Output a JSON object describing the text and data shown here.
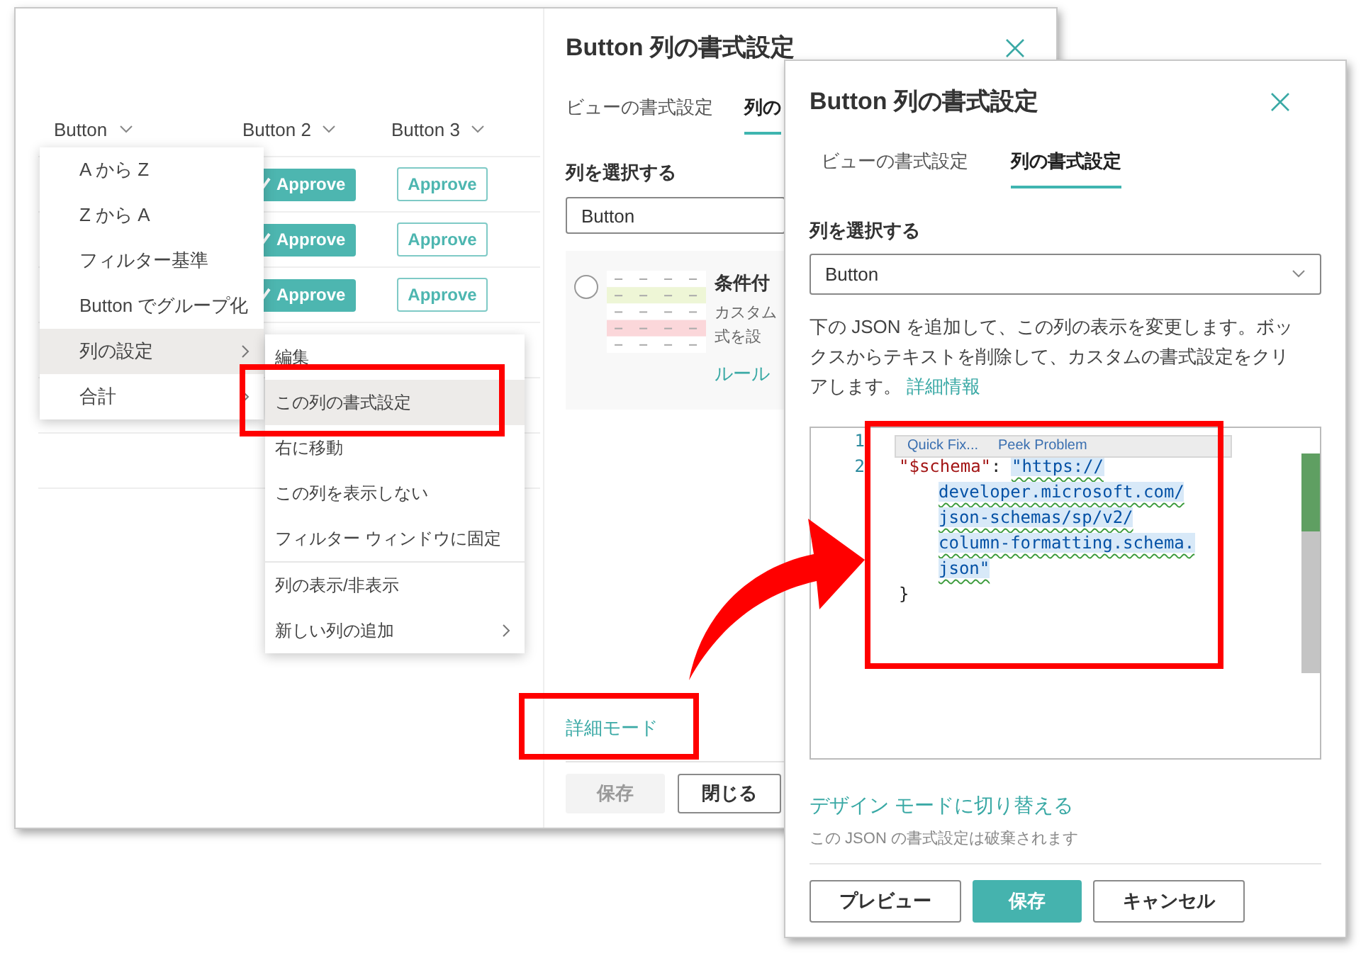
{
  "list_window": {
    "columns": [
      {
        "label": "Button"
      },
      {
        "label": "Button 2"
      },
      {
        "label": "Button 3"
      }
    ],
    "rows": [
      {
        "cells": [
          {
            "kind": "filled",
            "label": "Approve"
          },
          {
            "kind": "outlined",
            "label": "Approve"
          }
        ]
      },
      {
        "cells": [
          {
            "kind": "filled",
            "label": "Approve"
          },
          {
            "kind": "outlined",
            "label": "Approve"
          }
        ]
      },
      {
        "cells": [
          {
            "kind": "filled",
            "label": "Approve"
          },
          {
            "kind": "outlined",
            "label": "Approve"
          }
        ]
      }
    ],
    "column_menu": {
      "items": [
        {
          "label": "A から Z",
          "selected": false,
          "submenu": false
        },
        {
          "label": "Z から A",
          "selected": false,
          "submenu": false
        },
        {
          "label": "フィルター基準",
          "selected": false,
          "submenu": false
        },
        {
          "label": "Button でグループ化",
          "selected": false,
          "submenu": false
        },
        {
          "label": "列の設定",
          "selected": true,
          "submenu": true
        },
        {
          "label": "合計",
          "selected": false,
          "submenu": true
        }
      ]
    },
    "settings_submenu": {
      "items": [
        {
          "label": "編集",
          "selected": false,
          "submenu": false,
          "divider_before": false
        },
        {
          "label": "この列の書式設定",
          "selected": true,
          "submenu": false,
          "divider_before": false
        },
        {
          "label": "右に移動",
          "selected": false,
          "submenu": false,
          "divider_before": false
        },
        {
          "label": "この列を表示しない",
          "selected": false,
          "submenu": false,
          "divider_before": false
        },
        {
          "label": "フィルター ウィンドウに固定",
          "selected": false,
          "submenu": false,
          "divider_before": false
        },
        {
          "label": "列の表示/非表示",
          "selected": false,
          "submenu": false,
          "divider_before": true
        },
        {
          "label": "新しい列の追加",
          "selected": false,
          "submenu": true,
          "divider_before": false
        }
      ]
    },
    "format_panel": {
      "title": "Button 列の書式設定",
      "tabs": [
        {
          "label": "ビューの書式設定",
          "selected": false
        },
        {
          "label": "列の",
          "selected": true
        }
      ],
      "select_label": "列を選択する",
      "select_value": "Button",
      "rule_card": {
        "selected": false,
        "title": "条件付",
        "description_lines": [
          "カスタム",
          "式を設"
        ],
        "link": "ルール"
      },
      "advanced_link": "詳細モード",
      "buttons": [
        {
          "label": "保存",
          "kind": "primary",
          "disabled": true
        },
        {
          "label": "閉じる",
          "kind": "default",
          "disabled": false
        }
      ]
    }
  },
  "front_panel": {
    "title": "Button 列の書式設定",
    "tabs": [
      {
        "label": "ビューの書式設定",
        "selected": false
      },
      {
        "label": "列の書式設定",
        "selected": true
      }
    ],
    "select_label": "列を選択する",
    "select_value": "Button",
    "description": "下の JSON を追加して、この列の表示を変更します。ボックスからテキストを削除して、カスタムの書式設定をクリアします。",
    "learn_more_link": "詳細情報",
    "editor": {
      "hover_actions": [
        "Quick Fix...",
        "Peek Problem"
      ],
      "lines": [
        {
          "number": "1"
        },
        {
          "number": "2",
          "parts": [
            {
              "kind": "key",
              "text": "\"$schema\""
            },
            {
              "kind": "punct",
              "text": ": "
            },
            {
              "kind": "string",
              "text": "\"https://"
            }
          ],
          "continuations": [
            [
              {
                "kind": "string",
                "text": "developer.microsoft.com/"
              }
            ],
            [
              {
                "kind": "string",
                "text": "json-schemas/sp/v2/"
              }
            ],
            [
              {
                "kind": "string",
                "text": "column-formatting.schema."
              }
            ],
            [
              {
                "kind": "string",
                "text": "json\""
              }
            ]
          ]
        },
        {
          "parts": [
            {
              "kind": "punct",
              "text": "}"
            }
          ]
        }
      ]
    },
    "design_mode_link": "デザイン モードに切り替える",
    "design_mode_note": "この JSON の書式設定は破棄されます",
    "buttons": [
      {
        "label": "プレビュー",
        "kind": "default",
        "disabled": false
      },
      {
        "label": "保存",
        "kind": "primary",
        "disabled": false
      },
      {
        "label": "キャンセル",
        "kind": "default",
        "disabled": false
      }
    ]
  }
}
